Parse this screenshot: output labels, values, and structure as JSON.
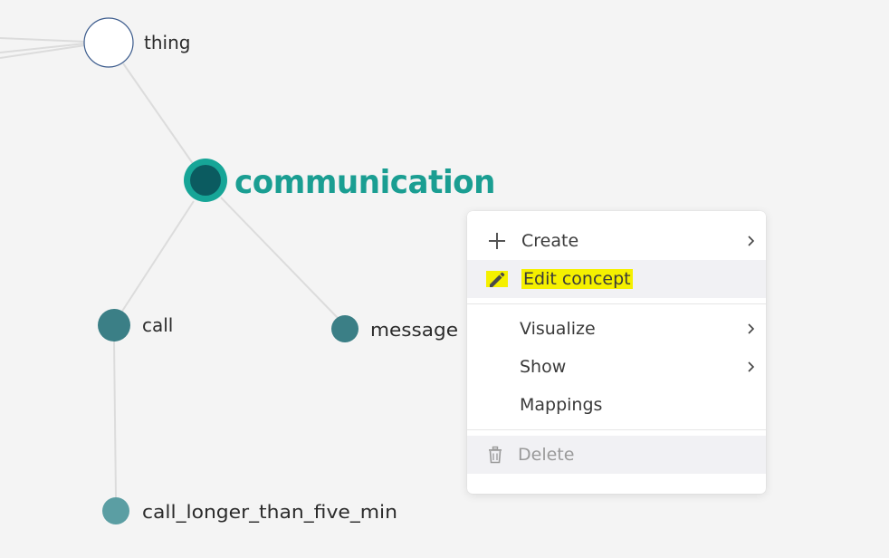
{
  "graph": {
    "nodes": [
      {
        "id": "thing",
        "label": "thing",
        "color": "#ffffff",
        "stroke": "#3a5a8c"
      },
      {
        "id": "communication",
        "label": "communication",
        "color": "#0b5b60",
        "ring": "#16a597",
        "focused": true
      },
      {
        "id": "call",
        "label": "call",
        "color": "#3b7f86"
      },
      {
        "id": "message",
        "label": "message",
        "color": "#3b7f86"
      },
      {
        "id": "call_longer_than_five_min",
        "label": "call_longer_than_five_min",
        "color": "#5b9ea3"
      }
    ],
    "edge_color": "#dcdcdc"
  },
  "context_menu": {
    "create": {
      "label": "Create",
      "icon": "plus-icon",
      "has_submenu": true
    },
    "edit_concept": {
      "label": "Edit concept",
      "icon": "pencil-icon",
      "highlight_color": "#f5f000"
    },
    "visualize": {
      "label": "Visualize",
      "has_submenu": true
    },
    "show": {
      "label": "Show",
      "has_submenu": true
    },
    "mappings": {
      "label": "Mappings"
    },
    "delete": {
      "label": "Delete",
      "icon": "trash-icon",
      "disabled": true
    }
  },
  "colors": {
    "background": "#f4f4f4",
    "accent": "#1a9e92",
    "highlight": "#f5f000"
  }
}
